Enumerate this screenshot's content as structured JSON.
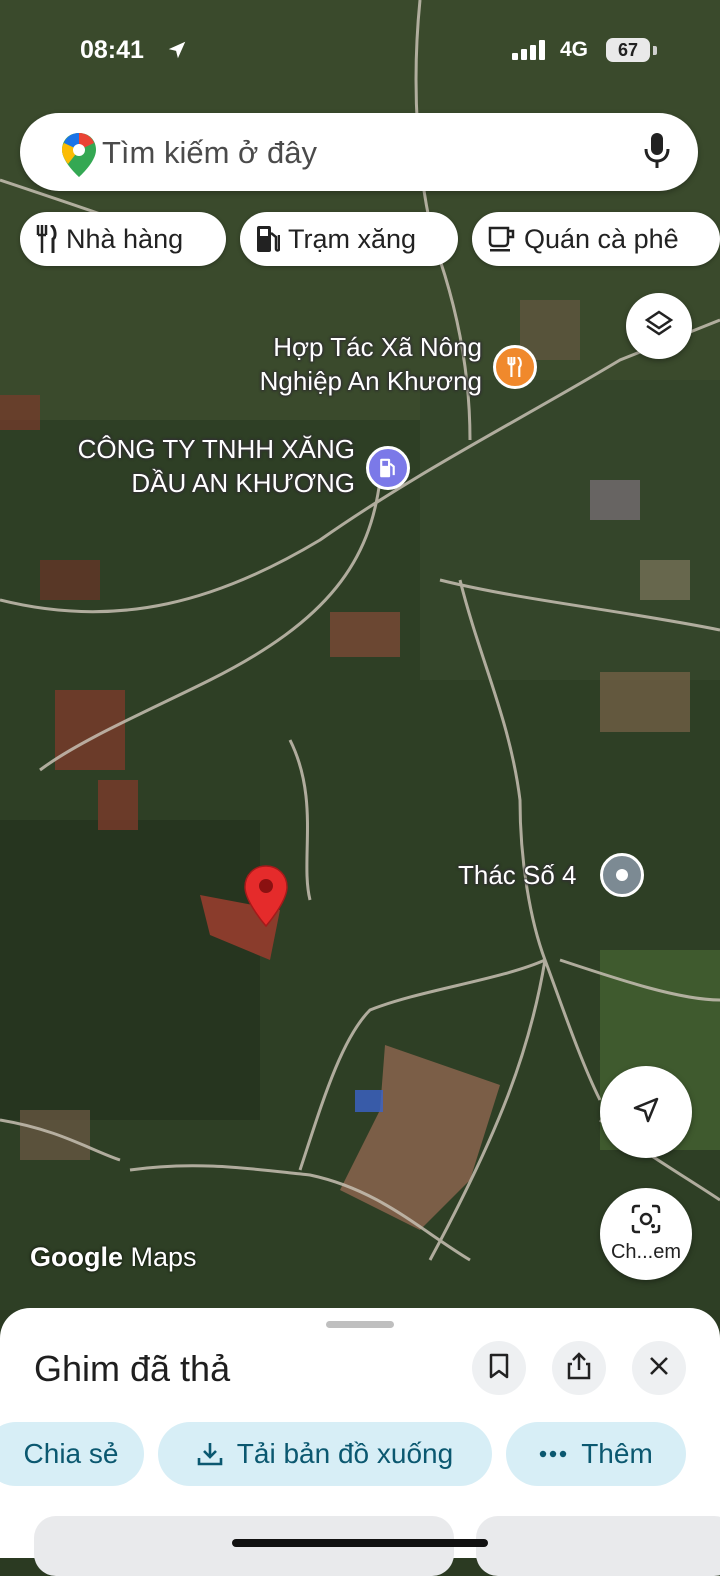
{
  "status_bar": {
    "time": "08:41",
    "network": "4G",
    "battery": "67"
  },
  "search": {
    "placeholder": "Tìm kiếm ở đây"
  },
  "chips": [
    {
      "label": "Nhà hàng",
      "icon": "fork-knife-icon"
    },
    {
      "label": "Trạm xăng",
      "icon": "gas-station-icon"
    },
    {
      "label": "Quán cà phê",
      "icon": "coffee-cup-icon"
    }
  ],
  "map": {
    "places": {
      "coop": "Hợp Tác Xã Nông Nghiệp An Khương",
      "gas_company": "CÔNG TY TNHH XĂNG DẦU AN KHƯƠNG",
      "waterfall": "Thác Số 4"
    },
    "watermark": {
      "brand": "Google",
      "product": "Maps"
    },
    "lens_button_label": "Ch...em",
    "colors": {
      "restaurant_pin": "#f0892c",
      "gas_pin": "#7b79e8",
      "dropped_pin": "#e52b2b",
      "place_pin": "#7c8a93"
    }
  },
  "sheet": {
    "title": "Ghim đã thả",
    "actions": [
      {
        "label": "Chia sẻ"
      },
      {
        "label": "Tải bản đồ xuống",
        "icon": "download-icon"
      },
      {
        "label": "Thêm",
        "icon": "more-dots-icon"
      }
    ],
    "accent": "#0b5870",
    "chip_bg": "#d7eef6"
  }
}
